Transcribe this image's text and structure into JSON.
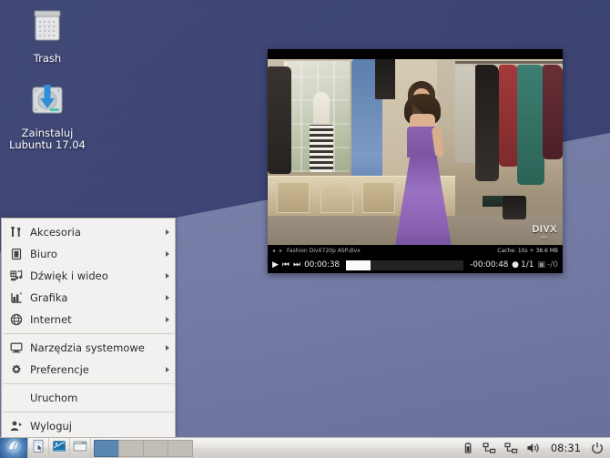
{
  "desktop": {
    "icons": [
      {
        "name": "trash",
        "label": "Trash",
        "icon": "trash-icon"
      },
      {
        "name": "install",
        "label": "Zainstaluj\nLubuntu 17.04",
        "label_line1": "Zainstaluj",
        "label_line2": "Lubuntu 17.04",
        "icon": "install-disc-icon"
      }
    ],
    "wallpaper_colors": {
      "upper": "#3b4274",
      "lower": "#767da8"
    }
  },
  "player": {
    "window_title": "Fashion DivX720p ASP.divx",
    "cache_status": "Cache: 10s + 38.6 MB",
    "time_elapsed": "00:00:38",
    "time_remaining": "-00:00:48",
    "chapter": "1/1",
    "frames": "-/0",
    "progress_percent": 21,
    "watermark": "DIVX",
    "watermark_sub": "HD",
    "buttons": {
      "play": "play-icon",
      "prev": "previous-track-icon",
      "next": "next-track-icon",
      "prev_chapter": "chevron-left-icon",
      "next_chapter": "chevron-right-icon",
      "chapter_icon": "chapter-marker-icon",
      "frames_icon": "frame-counter-icon"
    }
  },
  "appmenu": {
    "items": [
      {
        "label": "Akcesoria",
        "icon": "accessories-icon",
        "submenu": true
      },
      {
        "label": "Biuro",
        "icon": "office-icon",
        "submenu": true
      },
      {
        "label": "Dźwięk i wideo",
        "icon": "multimedia-icon",
        "submenu": true
      },
      {
        "label": "Grafika",
        "icon": "graphics-icon",
        "submenu": true
      },
      {
        "label": "Internet",
        "icon": "internet-globe-icon",
        "submenu": true
      }
    ],
    "items2": [
      {
        "label": "Narzędzia systemowe",
        "icon": "system-monitor-icon",
        "submenu": true
      },
      {
        "label": "Preferencje",
        "icon": "preferences-gear-icon",
        "submenu": true
      }
    ],
    "run_label": "Uruchom",
    "logout": {
      "label": "Wyloguj",
      "icon": "logout-user-icon"
    }
  },
  "taskbar": {
    "start_button": "lubuntu-start-icon",
    "quicklaunch": [
      {
        "name": "file-manager",
        "icon": "file-manager-icon"
      },
      {
        "name": "web-browser",
        "icon": "web-browser-icon"
      },
      {
        "name": "terminal",
        "icon": "terminal-window-icon"
      }
    ],
    "pager": {
      "count": 4,
      "active_index": 0
    },
    "tray": [
      {
        "name": "battery",
        "icon": "battery-icon"
      },
      {
        "name": "network-1",
        "icon": "network-icon"
      },
      {
        "name": "network-2",
        "icon": "network-icon"
      },
      {
        "name": "volume",
        "icon": "volume-icon"
      }
    ],
    "clock": "08:31",
    "power_button": "power-icon"
  }
}
